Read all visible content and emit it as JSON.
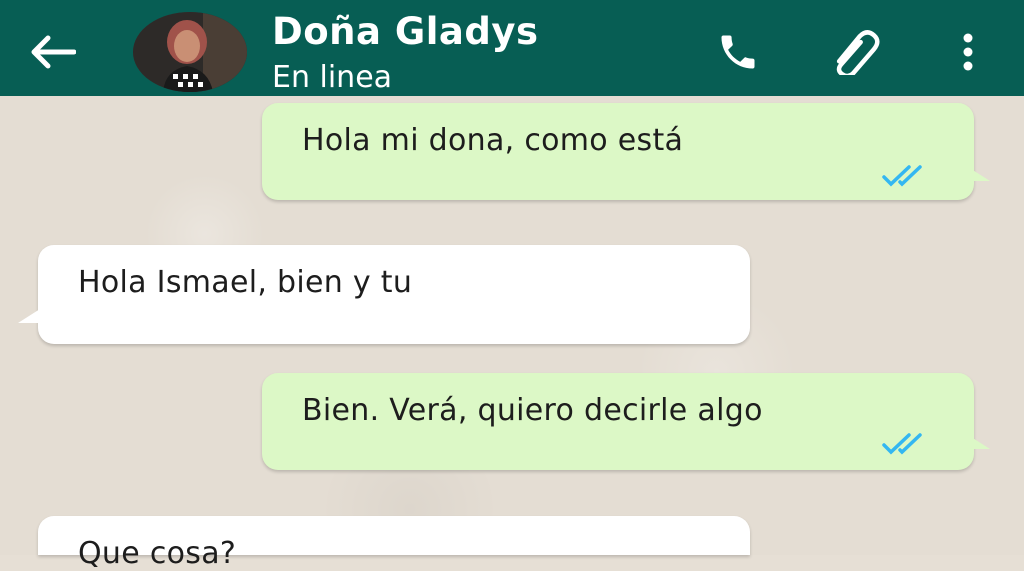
{
  "header": {
    "contact_name": "Doña Gladys",
    "status": "En linea",
    "colors": {
      "bar": "#075e54",
      "icon": "#ffffff"
    },
    "icons": [
      "back-arrow-icon",
      "phone-icon",
      "paperclip-icon",
      "more-vert-icon"
    ]
  },
  "messages": [
    {
      "direction": "outgoing",
      "text": "Hola mi dona, como está",
      "read": true
    },
    {
      "direction": "incoming",
      "text": "Hola Ismael, bien y tu"
    },
    {
      "direction": "outgoing",
      "text": "Bien. Verá, quiero decirle algo",
      "read": true
    },
    {
      "direction": "incoming",
      "text": "Que cosa?"
    }
  ],
  "colors": {
    "outgoing_bubble": "#dcf8c6",
    "incoming_bubble": "#ffffff",
    "read_ticks": "#34b7f1",
    "chat_background": "#e4ddd3"
  }
}
